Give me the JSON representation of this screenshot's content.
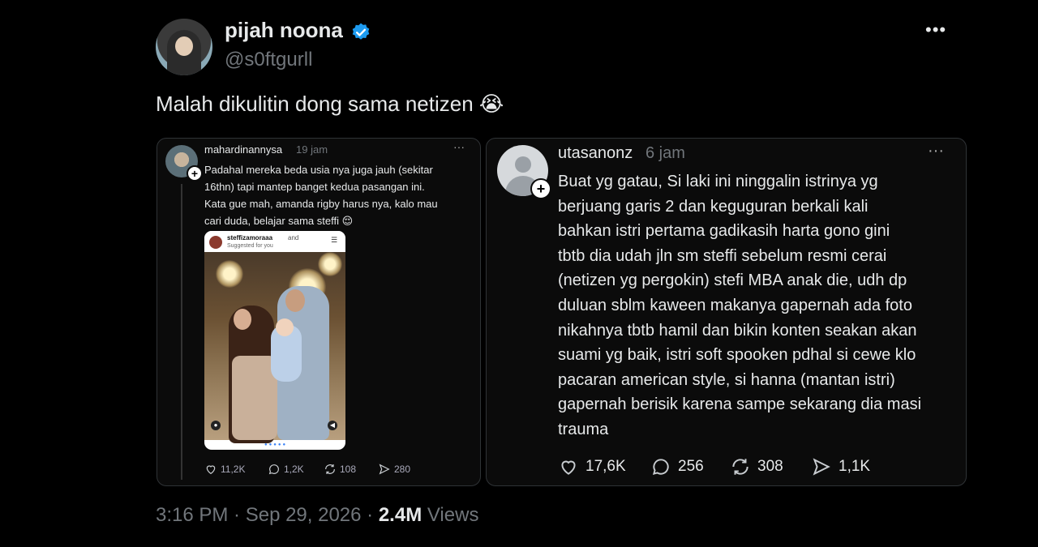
{
  "author": {
    "name": "pijah noona",
    "handle": "@s0ftgurll",
    "verified": true
  },
  "tweet": {
    "text": "Malah dikulitin dong sama netizen 😭",
    "time": "3:16 PM · Sep 29, 2026 · ",
    "views_count": "2.4M",
    "views_label": " Views"
  },
  "left_card": {
    "user": "mahardinannysa",
    "time": "19 jam",
    "more": "···",
    "body": "Padahal mereka beda usia nya juga jauh (sekitar\n16thn) tapi mantep banget kedua pasangan ini.\nKata gue mah, amanda rigby harus nya, kalo mau\ncari duda, belajar sama steffi 😌",
    "embed": {
      "user": "steffizamoraaa",
      "and": "and",
      "suggested": "Suggested for you",
      "dots": "●●●●●"
    },
    "stats": {
      "likes": "11,2K",
      "replies": "1,2K",
      "reposts": "108",
      "shares": "280"
    }
  },
  "right_card": {
    "user": "utasanonz",
    "time": "6 jam",
    "more": "···",
    "body": "Buat yg gatau, Si laki ini ninggalin istrinya yg\nberjuang garis 2 dan keguguran berkali kali\nbahkan istri pertama gadikasih harta gono gini\ntbtb dia udah jln sm steffi sebelum resmi cerai\n(netizen yg pergokin) stefi MBA anak die, udh dp\nduluan sblm kaween makanya gapernah ada foto\nnikahnya tbtb hamil dan bikin konten seakan akan\nsuami yg baik, istri soft spooken pdhal si cewe klo\npacaran american style, si hanna (mantan istri)\ngapernah berisik karena sampe sekarang dia masi\ntrauma",
    "stats": {
      "likes": "17,6K",
      "replies": "256",
      "reposts": "308",
      "shares": "1,1K"
    }
  },
  "colors": {
    "background": "#000000",
    "verified_badge": "#1d9bf0",
    "muted_text": "#71767b"
  }
}
